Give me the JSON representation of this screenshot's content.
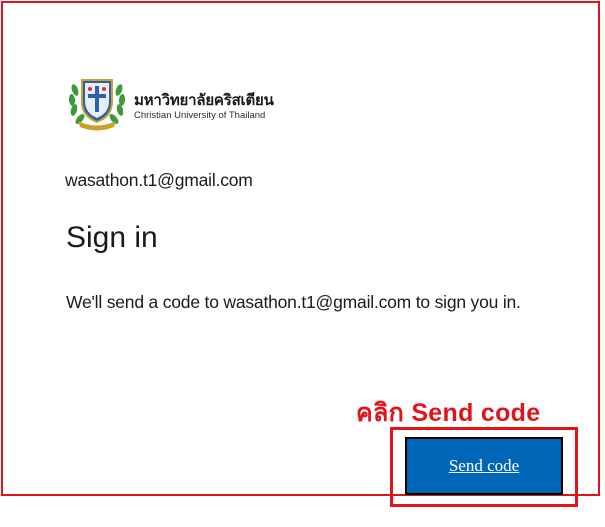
{
  "brand": {
    "name_th": "มหาวิทยาลัยคริสเตียน",
    "name_en": "Christian University of Thailand",
    "logo_icon": "university-crest-icon"
  },
  "identity": {
    "email": "wasathon.t1@gmail.com"
  },
  "heading": {
    "title": "Sign in"
  },
  "description": {
    "text": "We'll send a code to wasathon.t1@gmail.com to sign you in."
  },
  "annotation": {
    "text": "คลิก Send code",
    "color": "#e1141c"
  },
  "actions": {
    "send_code_label": "Send code",
    "button_color": "#0067b8"
  }
}
